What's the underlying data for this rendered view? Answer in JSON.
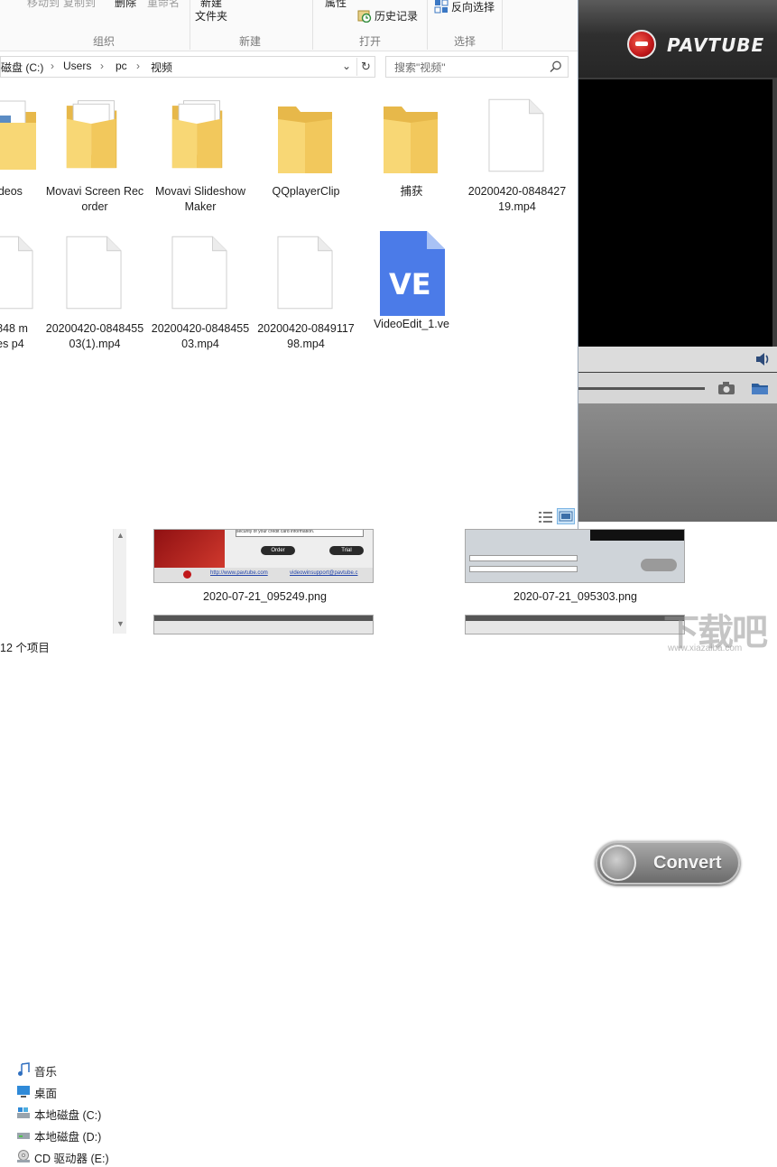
{
  "ribbon": {
    "faded_top": [
      "移动到",
      "复制到",
      "删除",
      "重命名"
    ],
    "new_button_top": "新建",
    "new_folder": "文件夹",
    "properties": "属性",
    "history": "历史记录",
    "invert_selection": "反向选择",
    "groups": [
      "组织",
      "新建",
      "打开",
      "选择"
    ]
  },
  "address": {
    "crumbs": [
      "磁盘 (C:)",
      "Users",
      "pc",
      "视频"
    ],
    "search_placeholder": "搜索\"视频\""
  },
  "items_row1": [
    {
      "label": "ideos",
      "kind": "folder-docs"
    },
    {
      "label": "Movavi Screen Recorder",
      "kind": "folder-docs"
    },
    {
      "label": "Movavi Slideshow Maker",
      "kind": "folder-docs"
    },
    {
      "label": "QQplayerClip",
      "kind": "folder"
    },
    {
      "label": "捕获",
      "kind": "folder"
    },
    {
      "label": "20200420-084842719.mp4",
      "kind": "file"
    }
  ],
  "items_row2": [
    {
      "label": "-0848 mpres p4",
      "kind": "file"
    },
    {
      "label": "20200420-084845503(1).mp4",
      "kind": "file"
    },
    {
      "label": "20200420-084845503.mp4",
      "kind": "file"
    },
    {
      "label": "20200420-084911798.mp4",
      "kind": "file"
    },
    {
      "label": "VideoEdit_1.ve",
      "kind": "ve",
      "icon_text": "VE"
    }
  ],
  "pavtube": {
    "logo_text": "PAVTUBE",
    "convert_label": "Convert"
  },
  "nav": [
    {
      "label": "音乐",
      "icon": "music-icon"
    },
    {
      "label": "桌面",
      "icon": "desktop-icon"
    },
    {
      "label": "本地磁盘 (C:)",
      "icon": "drive-icon"
    },
    {
      "label": "本地磁盘 (D:)",
      "icon": "drive-icon"
    },
    {
      "label": "CD 驱动器 (E:)",
      "icon": "cd-drive-icon"
    }
  ],
  "thumbnails": [
    {
      "name": "2020-07-21_095249.png",
      "strings": [
        "security of your credit card information.",
        "Order",
        "Trial",
        "http://www.pavtube.com",
        "videowinsupport@pavtube.c"
      ]
    },
    {
      "name": "2020-07-21_095303.png"
    }
  ],
  "status": {
    "count": "12 个项目"
  },
  "watermark": {
    "text": "下载吧",
    "sub": "www.xiazaiba.com"
  },
  "colors": {
    "folder": "#f8d775",
    "folder_dark": "#e7b84a",
    "ve_icon": "#4b7be8",
    "pavtube_red": "#c0171a"
  }
}
